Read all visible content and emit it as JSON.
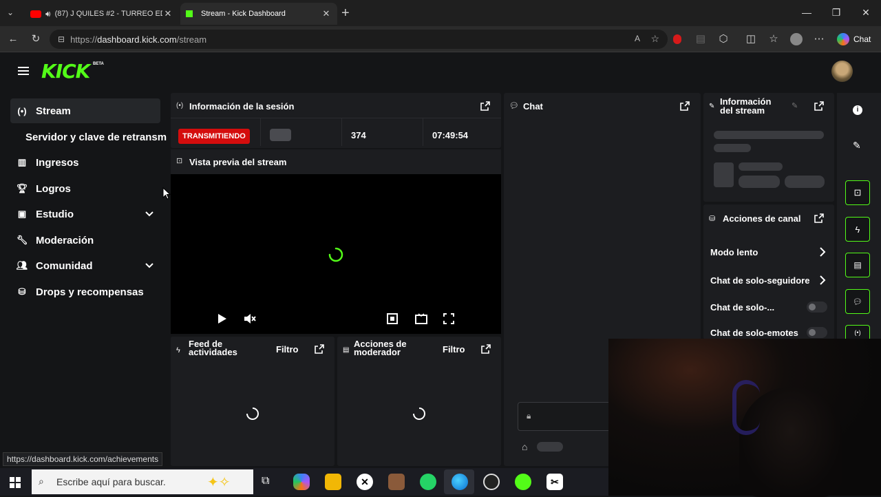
{
  "browser": {
    "tabs": [
      {
        "title": "(87) J QUILES #2 - TURREO ED"
      },
      {
        "title": "Stream - Kick Dashboard"
      }
    ],
    "url_prefix": "https://",
    "url_host": "dashboard.kick.com",
    "url_path": "/stream",
    "chat_label": "Chat"
  },
  "header": {
    "logo": "KICK",
    "beta": "BETA"
  },
  "sidebar": {
    "items": [
      {
        "label": "Stream",
        "icon": "broadcast-icon"
      },
      {
        "label": "Servidor y clave de retransm"
      },
      {
        "label": "Ingresos",
        "icon": "chart-icon"
      },
      {
        "label": "Logros",
        "icon": "trophy-icon"
      },
      {
        "label": "Estudio",
        "icon": "studio-icon"
      },
      {
        "label": "Moderación",
        "icon": "wrench-icon"
      },
      {
        "label": "Comunidad",
        "icon": "community-icon"
      },
      {
        "label": "Drops y recompensas",
        "icon": "drops-icon"
      }
    ]
  },
  "session": {
    "title": "Información de la sesión",
    "status": "TRANSMITIENDO",
    "viewers": "374",
    "uptime": "07:49:54"
  },
  "preview": {
    "title": "Vista previa del stream"
  },
  "activity": {
    "title_line1": "Feed de",
    "title_line2": "actividades",
    "filter": "Filtro"
  },
  "modactions": {
    "title_line1": "Acciones de",
    "title_line2": "moderador",
    "filter": "Filtro"
  },
  "chat": {
    "title": "Chat"
  },
  "streaminfo": {
    "title_line1": "Información",
    "title_line2": "del stream"
  },
  "channel_actions": {
    "title": "Acciones de canal",
    "items": [
      {
        "label": "Modo lento"
      },
      {
        "label": "Chat de solo-seguidore"
      },
      {
        "label": "Chat de solo-..."
      },
      {
        "label": "Chat de solo-emotes"
      }
    ]
  },
  "status_url": "https://dashboard.kick.com/achievements",
  "taskbar": {
    "search_placeholder": "Escribe aquí para buscar."
  },
  "colors": {
    "accent": "#53fc18",
    "live": "#d40d0d"
  }
}
